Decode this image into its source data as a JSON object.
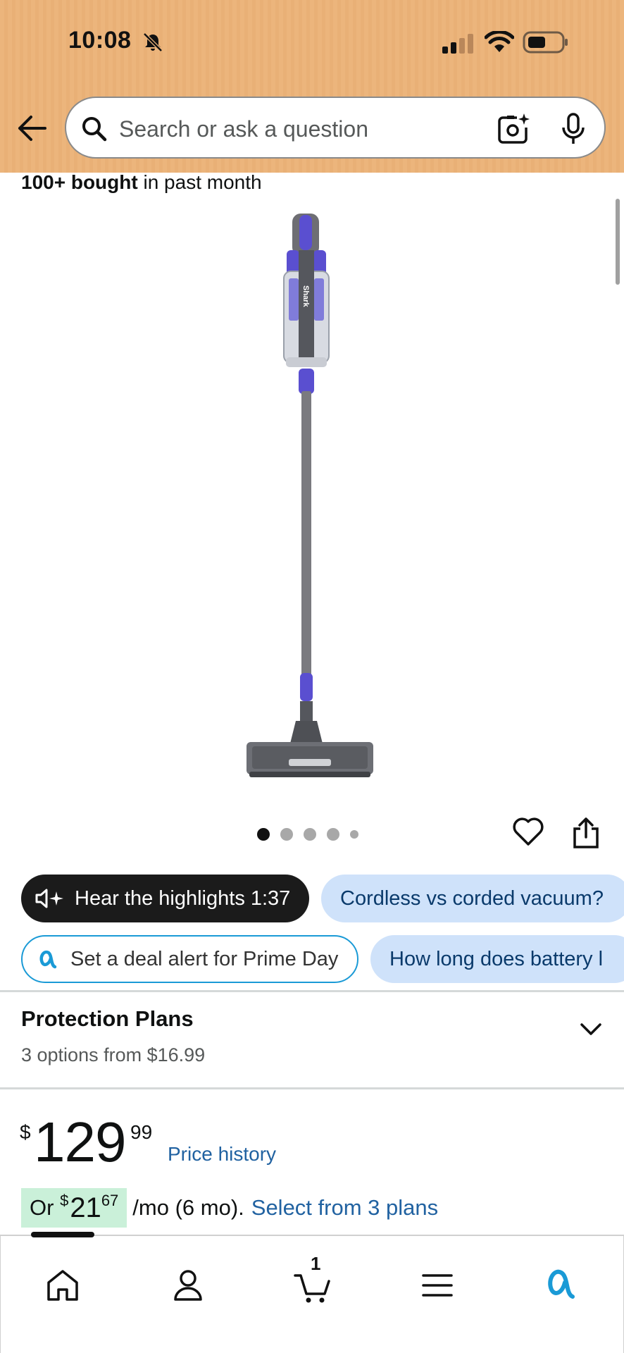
{
  "status_bar": {
    "time": "10:08"
  },
  "search": {
    "placeholder": "Search or ask a question"
  },
  "product": {
    "bought_strong": "100+ bought",
    "bought_rest": " in past month",
    "image_brand_text": "Shark",
    "image_count": 5,
    "active_image_index": 0
  },
  "chips": {
    "highlights": "Hear the highlights 1:37",
    "cordless": "Cordless vs corded vacuum?",
    "deal_alert": "Set a deal alert for Prime Day",
    "battery": "How long does battery l"
  },
  "protection": {
    "title": "Protection Plans",
    "subtitle": "3 options from $16.99"
  },
  "price": {
    "symbol": "$",
    "whole": "129",
    "fraction": "99",
    "history_link": "Price history"
  },
  "installment": {
    "prefix": "Or ",
    "symbol": "$",
    "whole": "21",
    "fraction": "67",
    "term": "/mo (6 mo).",
    "link": "Select from 3 plans"
  },
  "bottom_nav": {
    "cart_count": "1",
    "items": [
      "home-icon",
      "account-icon",
      "cart-icon",
      "menu-icon",
      "alexa-icon"
    ]
  },
  "colors": {
    "header_bg": "#ecb57c",
    "link": "#2162a1",
    "chip_blue": "#cfe2fa",
    "installment_green": "#caf0d9",
    "alexa_blue": "#1a9ad6"
  }
}
